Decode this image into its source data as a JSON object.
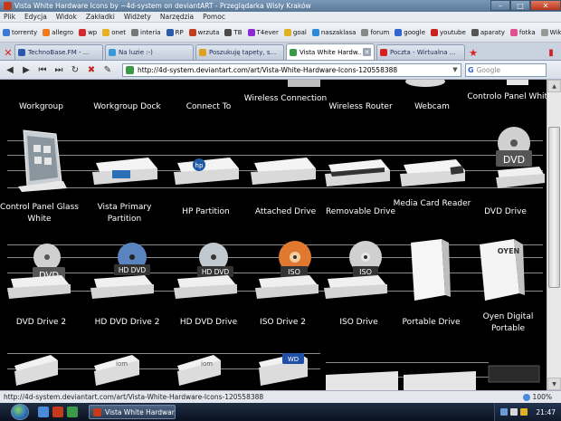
{
  "window": {
    "title": "Vista White Hardware Icons by ~4d-system on deviantART - Przeglądarka Wisły Kraków",
    "minimize": "–",
    "maximize": "□",
    "close": "✕"
  },
  "menu": [
    "Plik",
    "Edycja",
    "Widok",
    "Zakładki",
    "Widżety",
    "Narzędzia",
    "Pomoc"
  ],
  "bookmarks": [
    {
      "label": "torrenty",
      "color": "#3a7bd5"
    },
    {
      "label": "allegro",
      "color": "#f07a1a"
    },
    {
      "label": "wp",
      "color": "#d42a2a"
    },
    {
      "label": "onet",
      "color": "#e8b020"
    },
    {
      "label": "interia",
      "color": "#777777"
    },
    {
      "label": "RP",
      "color": "#2a5aa8"
    },
    {
      "label": "wrzuta",
      "color": "#c43b1c"
    },
    {
      "label": "TB",
      "color": "#4a4a4a"
    },
    {
      "label": "T4ever",
      "color": "#8a2ad0"
    },
    {
      "label": "goal",
      "color": "#e0b020"
    },
    {
      "label": "naszaklasa",
      "color": "#2a8ad8"
    },
    {
      "label": "forum",
      "color": "#888888"
    },
    {
      "label": "google",
      "color": "#3366cc"
    },
    {
      "label": "youtube",
      "color": "#cc2020"
    },
    {
      "label": "aparaty",
      "color": "#555555"
    },
    {
      "label": "fotka",
      "color": "#e05090"
    },
    {
      "label": "Wikipedia",
      "color": "#999999"
    }
  ],
  "tabs": [
    {
      "label": "TechnoBase.FM - ...",
      "color": "#2a5aa8",
      "active": false
    },
    {
      "label": "Na luzie :-)",
      "color": "#3a9ad8",
      "active": false
    },
    {
      "label": "Poszukuję tapety, s...",
      "color": "#e0a020",
      "active": false
    },
    {
      "label": "Vista White Hardw...",
      "color": "#3a9a49",
      "active": true
    },
    {
      "label": "Poczta - Wirtualna ...",
      "color": "#d42020",
      "active": false
    }
  ],
  "nav": {
    "url": "http://4d-system.deviantart.com/art/Vista-White-Hardware-Icons-120558388",
    "search_placeholder": "Google",
    "search_engine_glyph": "G"
  },
  "icons": {
    "row1": [
      "Workgroup",
      "Workgroup Dock",
      "Connect To",
      "Wireless Connection",
      "Wireless Router",
      "Webcam",
      "Controlo Panel White"
    ],
    "row2": [
      "Control Panel Glass White",
      "Vista Primary Partition",
      "HP Partition",
      "Attached Drive",
      "Removable Drive",
      "Media Card Reader",
      "DVD Drive"
    ],
    "row3": [
      "DVD  Drive 2",
      "HD DVD Drive 2",
      "HD DVD Drive",
      "ISO Drive 2",
      "ISO Drive",
      "Portable Drive",
      "Oyen Digital Portable"
    ]
  },
  "disc_badges": {
    "dvd": "DVD",
    "hddvd": "HD DVD",
    "iso": "ISO",
    "hp": "hp",
    "oyen": "OYEN",
    "wd": "WD",
    "iomega": "iom"
  },
  "status": {
    "text": "http://4d-system.deviantart.com/art/Vista-White-Hardware-Icons-120558388",
    "zoom": "100%"
  },
  "taskbar": {
    "item": "Vista White Hardwar...",
    "clock": "21:47"
  }
}
